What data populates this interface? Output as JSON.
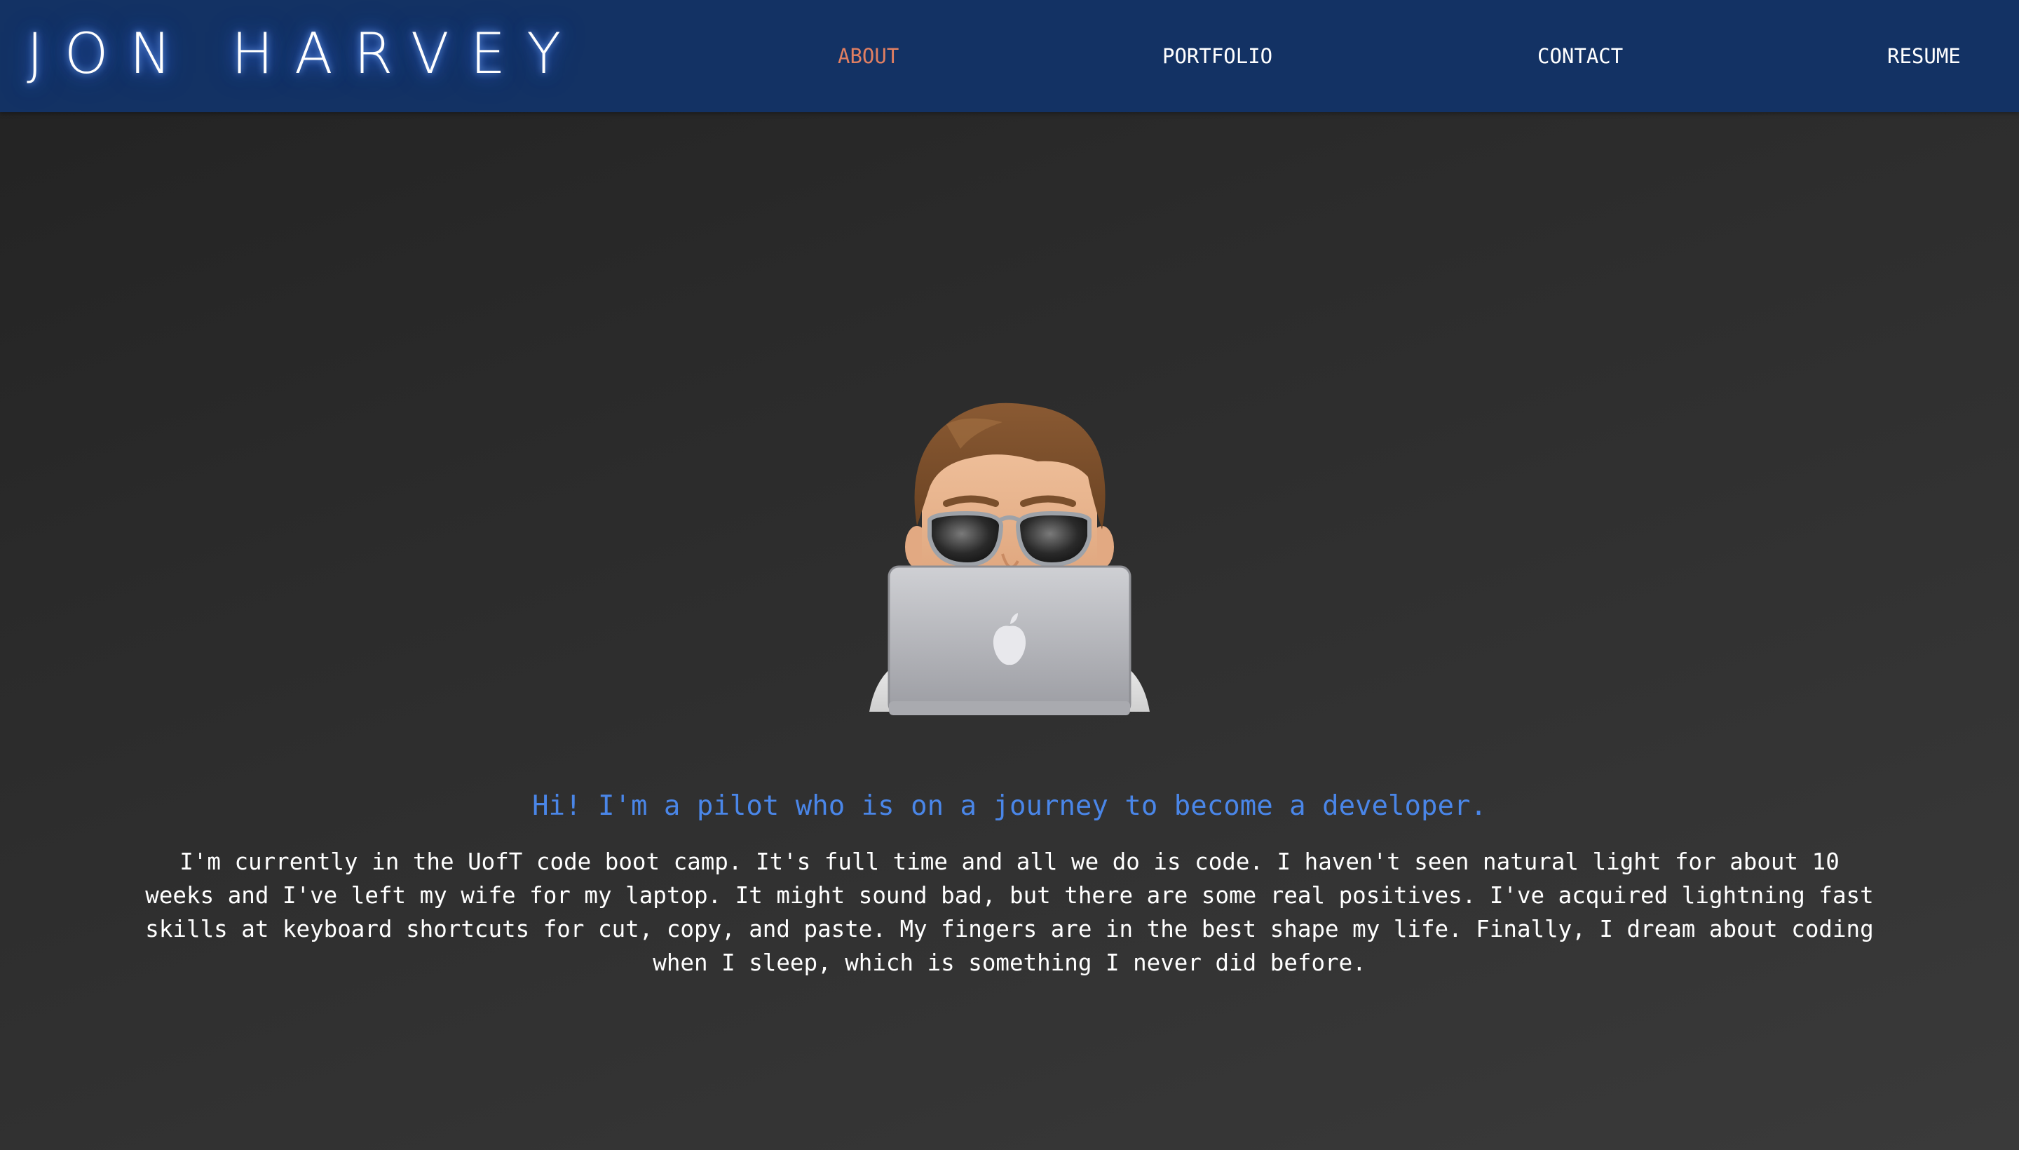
{
  "header": {
    "brand": "JON HARVEY",
    "nav": [
      {
        "label": "ABOUT",
        "active": true
      },
      {
        "label": "PORTFOLIO",
        "active": false
      },
      {
        "label": "CONTACT",
        "active": false
      },
      {
        "label": "RESUME",
        "active": false
      }
    ]
  },
  "about": {
    "headline": "Hi! I'm a pilot who is on a journey to become a developer.",
    "bio": "I'm currently in the UofT code boot camp. It's full time and all we do is code. I haven't seen natural light for about 10 weeks and I've left my wife for my laptop. It might sound bad, but there are some real positives. I've acquired lightning fast skills at keyboard shortcuts for cut, copy, and paste. My fingers are in the best shape my life. Finally, I dream about coding when I sleep, which is something I never did before.",
    "avatar_icon": "memoji-laptop-icon"
  },
  "colors": {
    "navbar": "#133264",
    "nav_active": "#e07f62",
    "headline": "#4a86e8",
    "background": "#2b2b2b"
  }
}
